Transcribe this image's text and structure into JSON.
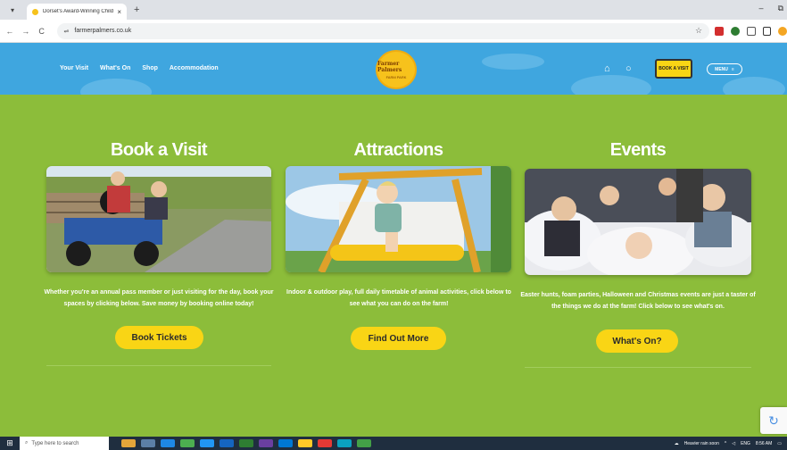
{
  "browser": {
    "tab_title": "Dorset's Award-Winning Childr",
    "tab_close": "×",
    "new_tab": "+",
    "url": "farmerpalmers.co.uk",
    "win_min": "–",
    "win_restore": "⧉",
    "back": "←",
    "forward": "→",
    "reload": "C",
    "tune": "⇌",
    "star": "☆"
  },
  "header": {
    "nav": [
      "Your Visit",
      "What's On",
      "Shop",
      "Accommodation"
    ],
    "logo_title": "Farmer Palmers",
    "logo_sub": "FARM PARK",
    "basket_icon": "⌂",
    "search_icon": "○",
    "book_button": "BOOK A VISIT",
    "menu_label": "MENU",
    "menu_icon": "≡"
  },
  "sections": [
    {
      "title": "Book a Visit",
      "description": "Whether you're an annual pass member or just visiting for the day, book your spaces by clicking below. Save money by booking online today!",
      "button": "Book Tickets"
    },
    {
      "title": "Attractions",
      "description": "Indoor & outdoor play, full daily timetable of animal activities, click below to see what you can do on the farm!",
      "button": "Find Out More"
    },
    {
      "title": "Events",
      "description": "Easter hunts, foam parties, Halloween and Christmas events are just a taster of the things we do at the farm! Click below to see what's on.",
      "button": "What's On?"
    }
  ],
  "taskbar": {
    "search_placeholder": "Type here to search",
    "weather": "Heavier rain soon",
    "lang": "ENG",
    "time": "8:56 AM"
  },
  "colors": {
    "page_green": "#8cbd3a",
    "header_blue": "#3fa6df",
    "button_yellow": "#f9d515"
  }
}
